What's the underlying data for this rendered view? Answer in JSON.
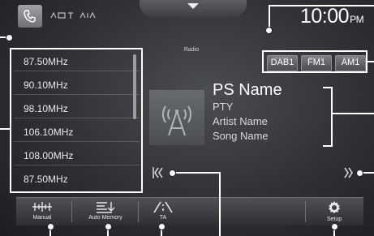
{
  "header": {
    "source_label": "Radio",
    "clock_time": "10:00",
    "clock_ampm": "PM"
  },
  "bands": [
    "DAB1",
    "FM1",
    "AM1"
  ],
  "presets": [
    "87.50MHz",
    "90.10MHz",
    "98.10MHz",
    "106.10MHz",
    "108.00MHz",
    "87.50MHz"
  ],
  "now_playing": {
    "ps_name": "PS Name",
    "pty": "PTY",
    "artist": "Artist Name",
    "song": "Song Name"
  },
  "bottom_bar": {
    "manual": "Manual",
    "auto_memory": "Auto Memory",
    "ta": "TA",
    "setup": "Setup"
  },
  "icons": {
    "phone": "phone-icon",
    "status": "status-indicator-icons",
    "source_menu": "chevron-down-icon",
    "album_art": "radio-antenna-icon",
    "seek_back": "seek-back-icon",
    "seek_fwd": "seek-forward-icon",
    "manual": "manual-tune-icon",
    "auto_memory": "auto-memory-icon",
    "ta": "traffic-announcement-icon",
    "setup": "gear-icon"
  },
  "colors": {
    "screen_bg": "#2e3034",
    "text": "#ffffff",
    "callout": "#ffffff"
  }
}
